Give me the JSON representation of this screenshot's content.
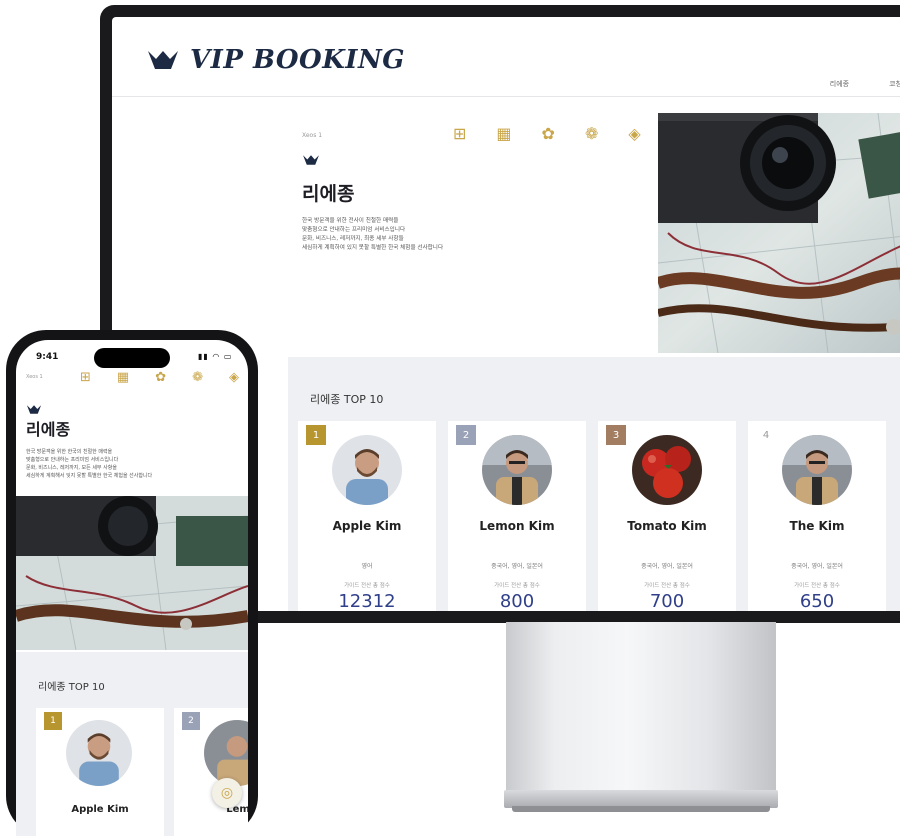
{
  "brand": {
    "name": "VIP BOOKING",
    "accent": "#c9a64a",
    "navy": "#1d2a44"
  },
  "nav": {
    "items": [
      "리에종",
      "코칭"
    ]
  },
  "hero": {
    "label": "Xeos 1",
    "icons": [
      "grid-icon",
      "grid-alt-icon",
      "flower-icon",
      "ornament-icon",
      "gem-icon"
    ],
    "title": "리에종",
    "description": [
      "한국 방문객을 위한 전사이 친절한 매력을",
      "맞춤형으로 안내하는 프리미엄 서비스입니다",
      "문화, 비즈니스, 레저까지, 최종 세부 사항들",
      "세심하게 계획하여 있지 못할 특별한 한국 체험을 선사합니다"
    ]
  },
  "top10": {
    "title": "리에종 TOP 10",
    "caption": "가이드 전산 총 점수",
    "cards": [
      {
        "rank": "1",
        "name": "Apple Kim",
        "langs": "영어",
        "score": "12312",
        "badge_color": "#b8962f"
      },
      {
        "rank": "2",
        "name": "Lemon Kim",
        "langs": "중국어, 영어, 일본어",
        "score": "800",
        "badge_color": "#9aa2b8"
      },
      {
        "rank": "3",
        "name": "Tomato Kim",
        "langs": "중국어, 영어, 일본어",
        "score": "700",
        "badge_color": "#a37d62"
      },
      {
        "rank": "4",
        "name": "The Kim",
        "langs": "중국어, 영어, 일본어",
        "score": "650",
        "badge_color": "#ffffff"
      }
    ]
  },
  "phone": {
    "time": "9:41",
    "status": "▮▮ ◠ ▭",
    "label": "Xeos 1",
    "title": "리에종",
    "description": [
      "한국 방문객을 위한 한국의 친절한 매력을",
      "맞춤형으로 안내하는 프리미엄 서비스입니다",
      "문화, 비즈니스, 레저까지, 모든 세부 사항을",
      "세심하게 계획해서 잊지 못할 특별한 한국 체험을 선사합니다"
    ],
    "top_title": "리에종 TOP 10",
    "cards": [
      {
        "rank": "1",
        "name": "Apple Kim"
      },
      {
        "rank": "2",
        "name": "Lem"
      }
    ]
  }
}
